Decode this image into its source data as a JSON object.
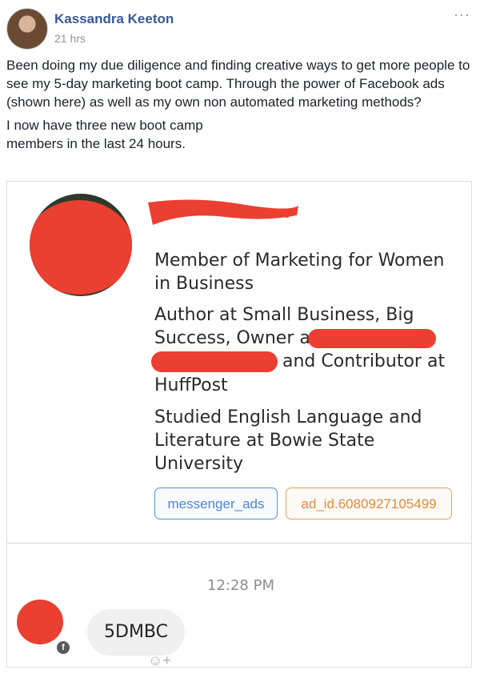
{
  "post": {
    "author": "Kassandra Keeton",
    "time": "21 hrs",
    "more_icon": "···",
    "text_p1": "Been doing my due diligence and finding creative ways to get more people to see my 5-day marketing boot camp. Through the power of Facebook ads (shown here) as well as my own non automated marketing methods?",
    "text_p2": "I now have three new boot camp members in the last 24 hours."
  },
  "profile": {
    "detail_1": "Member of Marketing for Women in Business",
    "detail_2a": "Author at Small Business, Big Success, Owner at",
    "detail_2b": "and Contributor at",
    "detail_2c": "HuffPost",
    "detail_3": "Studied English Language and Literature at Bowie State University",
    "tags": [
      "messenger_ads",
      "ad_id.6080927105499"
    ]
  },
  "chat": {
    "time": "12:28 PM",
    "message": "5DMBC",
    "fb_badge": "f",
    "react_icon": "☺+"
  },
  "colors": {
    "author_blue": "#365899",
    "redaction_red": "#ea3f31",
    "tag_blue": "#4d86d4",
    "tag_orange": "#e08b3d"
  }
}
